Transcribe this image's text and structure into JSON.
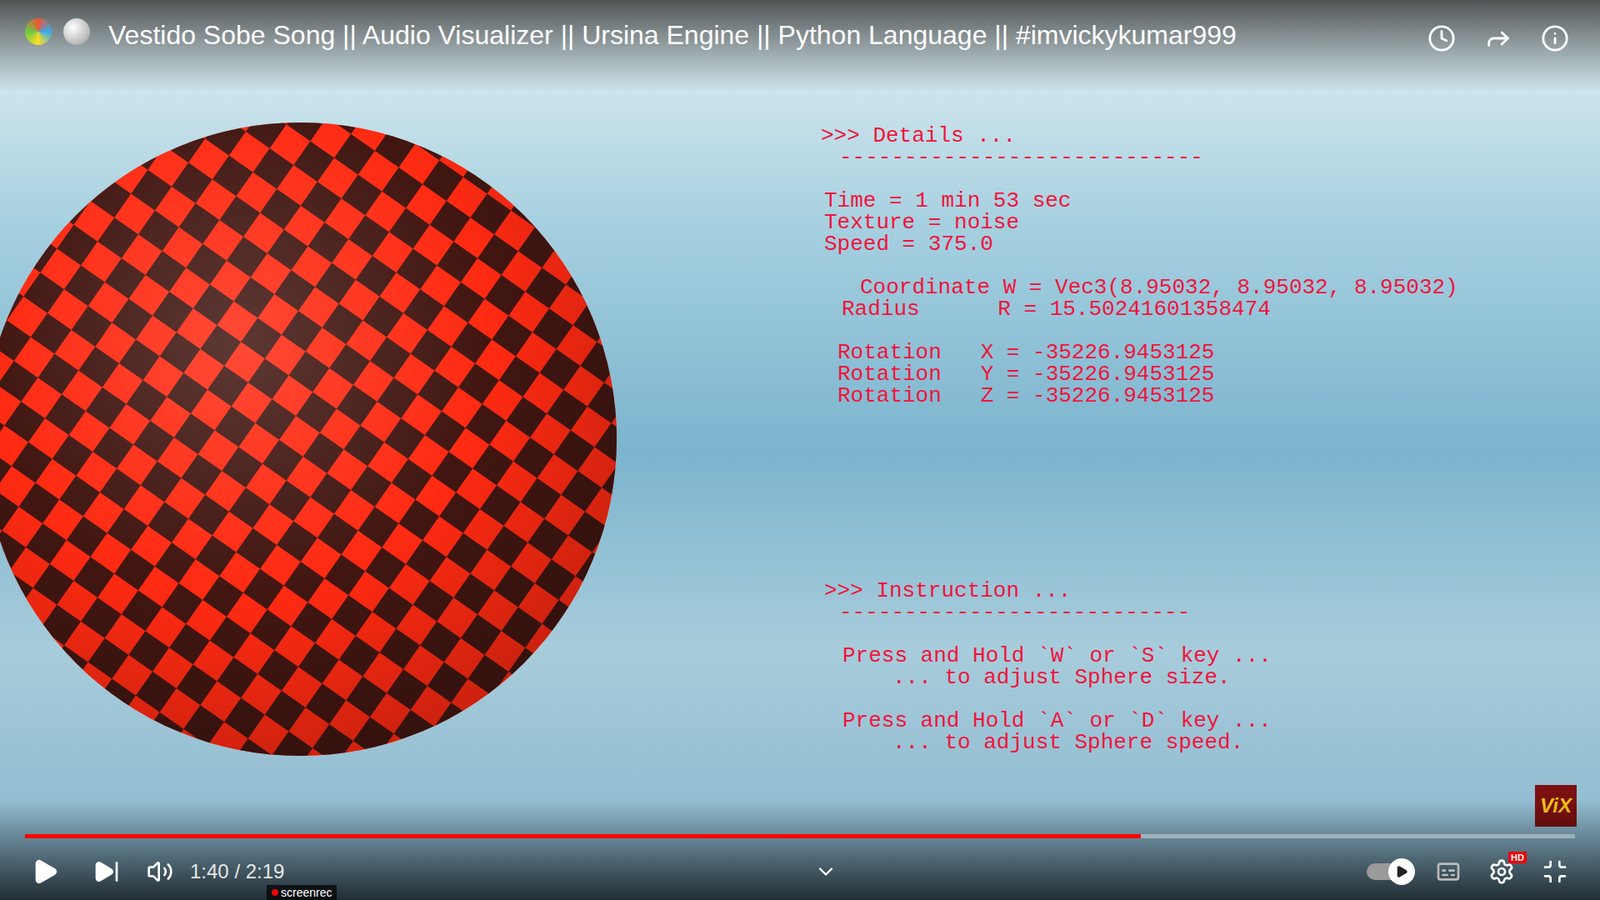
{
  "player": {
    "title": "Vestido Sobe Song || Audio Visualizer || Ursina Engine || Python Language || #imvickykumar999",
    "time": "1:40 / 2:19",
    "progress": 0.72,
    "autoplay_on": true,
    "quality_badge": "HD"
  },
  "scene": {
    "details_heading": ">>> Details ...",
    "details_rule": "----------------------------",
    "stats": [
      "Time = 1 min 53 sec",
      "Texture = noise",
      "Speed = 375.0"
    ],
    "coordinate": "Coordinate W = Vec3(8.95032, 8.95032, 8.95032)",
    "radius": "Radius      R = 15.50241601358474",
    "rotations": [
      "Rotation   X = -35226.9453125",
      "Rotation   Y = -35226.9453125",
      "Rotation   Z = -35226.9453125"
    ],
    "instruction_heading": ">>> Instruction ...",
    "instruction_rule": "---------------------------",
    "instructions": [
      {
        "action": "Press and Hold `W` or `S` key ...",
        "effect": "... to adjust Sphere size."
      },
      {
        "action": "Press and Hold `A` or `D` key ...",
        "effect": "... to adjust Sphere speed."
      }
    ]
  },
  "watermarks": {
    "recorder": "screenrec",
    "logo": "ViX"
  }
}
